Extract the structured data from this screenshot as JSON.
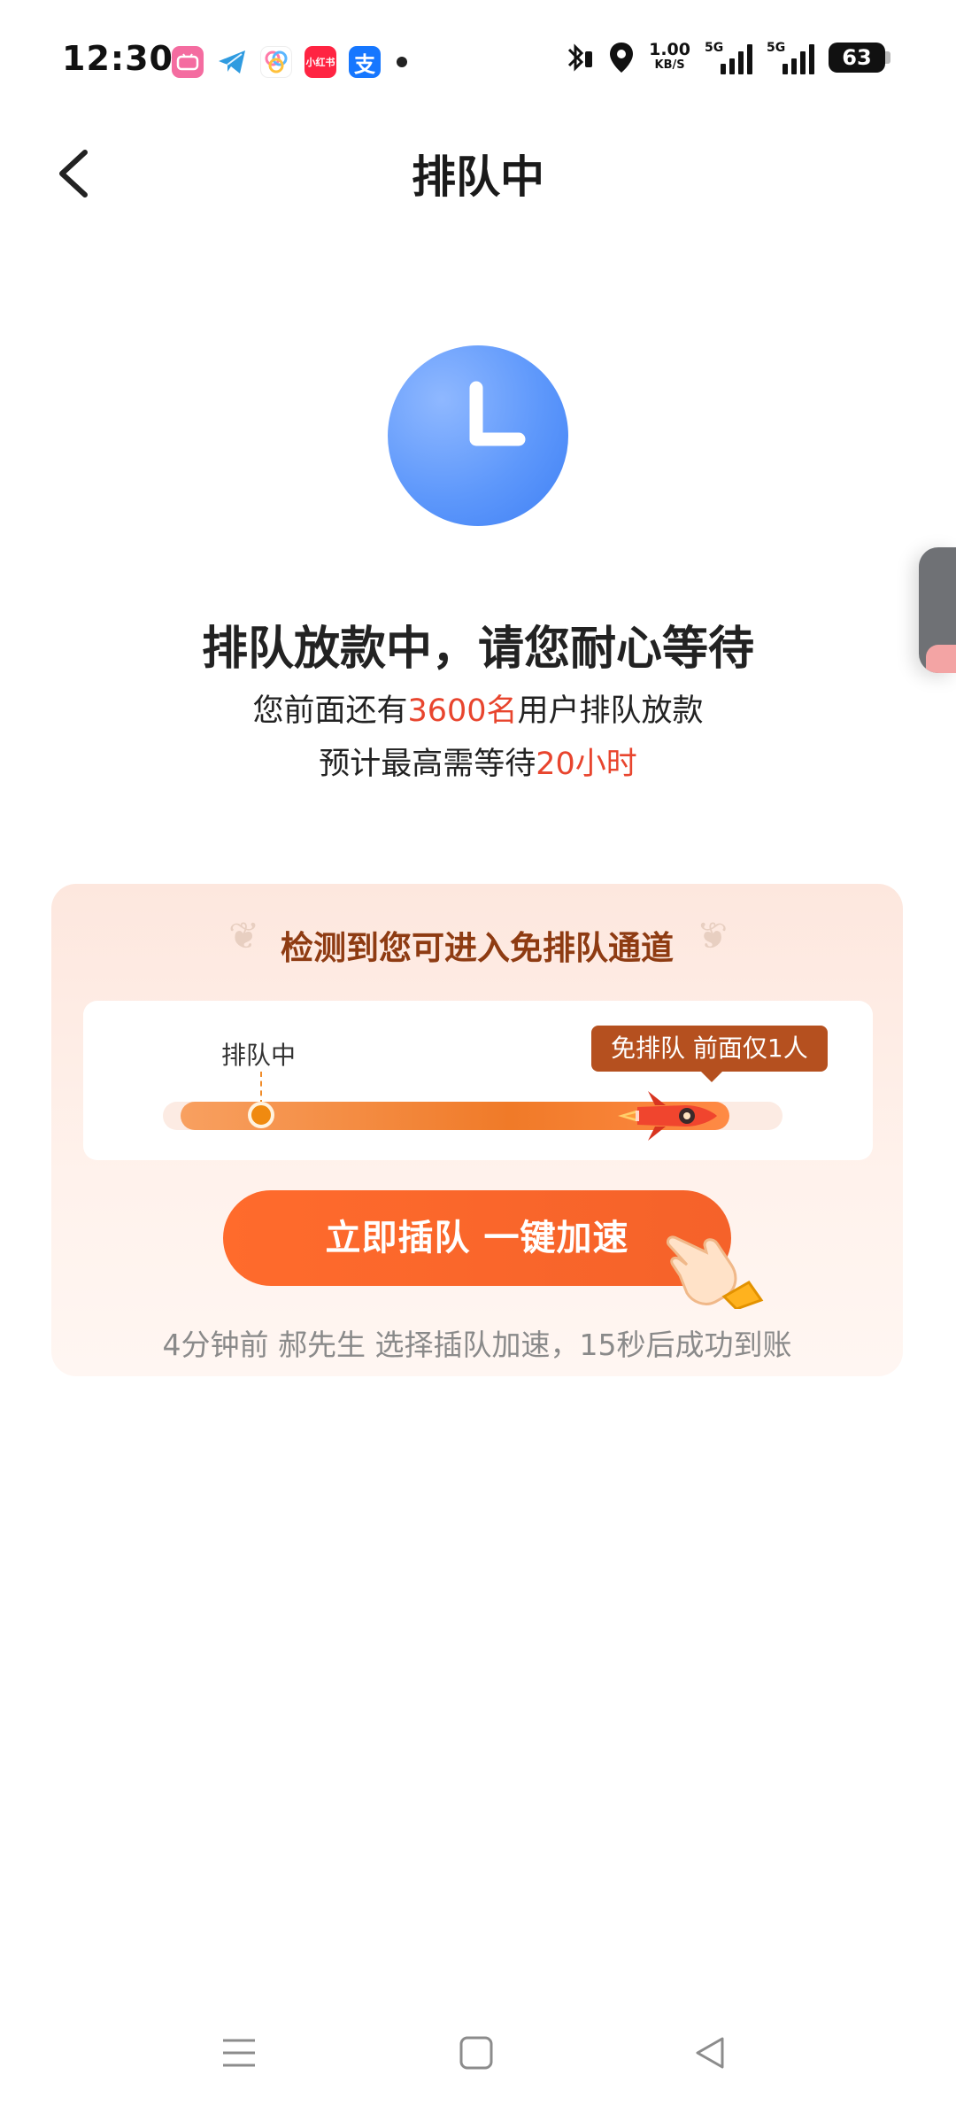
{
  "status_bar": {
    "time": "12:30",
    "net_speed_value": "1.00",
    "net_speed_unit": "KB/S",
    "signal1_label": "5G",
    "signal2_label": "5G",
    "battery": "63",
    "app_icons": [
      "bilibili-icon",
      "telegram-icon",
      "app-icon",
      "xiaohongshu-icon",
      "alipay-icon"
    ],
    "xiaohongshu_text": "小红书",
    "alipay_text": "支"
  },
  "header": {
    "title": "排队中"
  },
  "status": {
    "main_message": "排队放款中，请您耐心等待",
    "line1_prefix": "您前面还有",
    "line1_highlight": "3600名",
    "line1_suffix": "用户排队放款",
    "line2_prefix": "预计最高需等待",
    "line2_highlight": "20小时"
  },
  "promo": {
    "title": "检测到您可进入免排队通道",
    "queue_label": "排队中",
    "fast_label": "免排队  前面仅1人",
    "cta_label": "立即插队  一键加速",
    "footer": "4分钟前 郝先生 选择插队加速，15秒后成功到账"
  },
  "colors": {
    "accent": "#f5622a",
    "highlight_red": "#e8452e",
    "clock_blue": "#5e98fb"
  }
}
